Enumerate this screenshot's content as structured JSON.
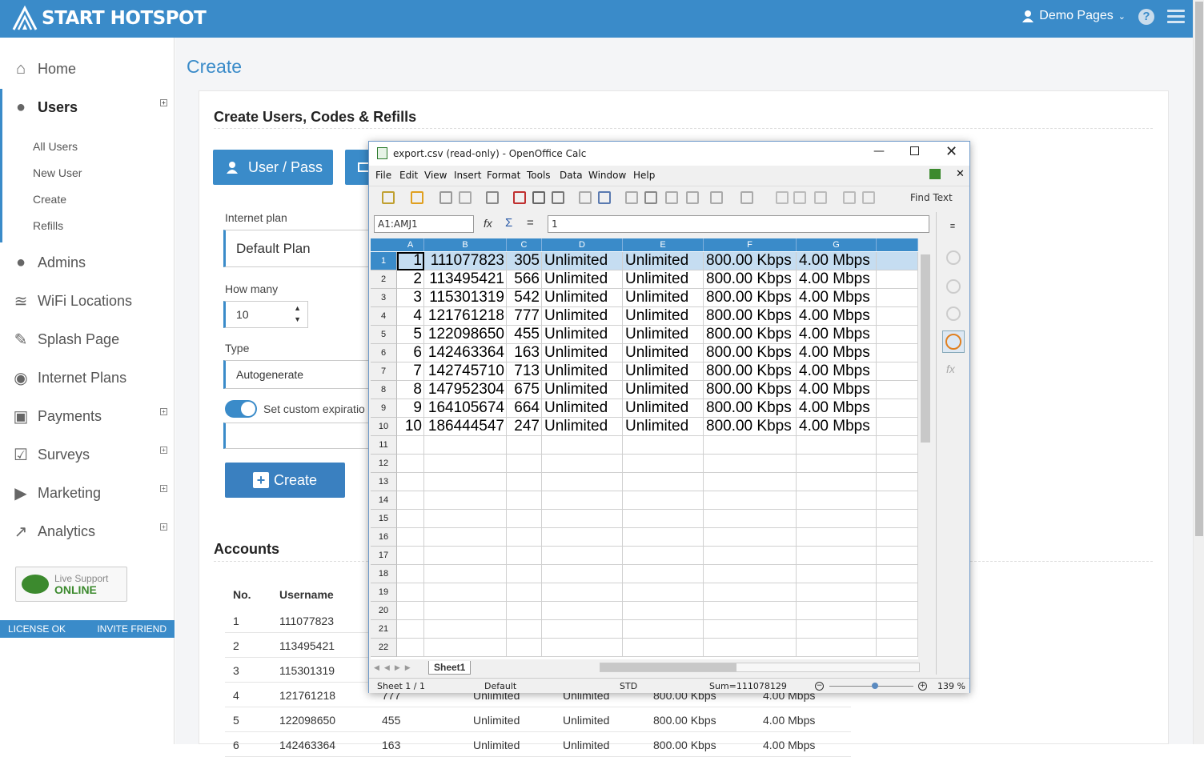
{
  "app": {
    "logo": "START HOTSPOT",
    "user": "Demo Pages",
    "help": "?"
  },
  "sidebar": {
    "items": [
      {
        "label": "Home",
        "icon": "home-icon",
        "plus": false
      },
      {
        "label": "Users",
        "icon": "user-icon",
        "plus": true
      },
      {
        "label": "Admins",
        "icon": "user-icon",
        "plus": false
      },
      {
        "label": "WiFi Locations",
        "icon": "wifi-icon",
        "plus": false
      },
      {
        "label": "Splash Page",
        "icon": "edit-icon",
        "plus": false
      },
      {
        "label": "Internet Plans",
        "icon": "globe-icon",
        "plus": false
      },
      {
        "label": "Payments",
        "icon": "credit-card-icon",
        "plus": true
      },
      {
        "label": "Surveys",
        "icon": "checkbox-icon",
        "plus": true
      },
      {
        "label": "Marketing",
        "icon": "video-icon",
        "plus": true
      },
      {
        "label": "Analytics",
        "icon": "chart-icon",
        "plus": true
      }
    ],
    "sub": [
      "All Users",
      "New User",
      "Create",
      "Refills"
    ],
    "live_support": {
      "line1": "Live Support",
      "line2": "ONLINE"
    },
    "footer": {
      "left": "LICENSE OK",
      "right": "INVITE FRIEND"
    }
  },
  "page": {
    "title": "Create",
    "section": "Create Users, Codes & Refills",
    "accounts": "Accounts"
  },
  "form": {
    "tab_userpass": "User / Pass",
    "plan_label": "Internet plan",
    "plan_value": "Default Plan",
    "howmany_label": "How many",
    "howmany_value": "10",
    "type_label": "Type",
    "type_value": "Autogenerate",
    "expire_label": "Set custom expiratio",
    "create_btn": "Create"
  },
  "accounts": {
    "headers": [
      "No.",
      "Username"
    ],
    "rows": [
      {
        "no": "1",
        "user": "111077823",
        "pass": "",
        "a": "",
        "b": "",
        "c": "",
        "d": ""
      },
      {
        "no": "2",
        "user": "113495421",
        "pass": "",
        "a": "",
        "b": "",
        "c": "",
        "d": ""
      },
      {
        "no": "3",
        "user": "115301319",
        "pass": "",
        "a": "",
        "b": "",
        "c": "",
        "d": ""
      },
      {
        "no": "4",
        "user": "121761218",
        "pass": "777",
        "a": "Unlimited",
        "b": "Unlimited",
        "c": "800.00 Kbps",
        "d": "4.00 Mbps"
      },
      {
        "no": "5",
        "user": "122098650",
        "pass": "455",
        "a": "Unlimited",
        "b": "Unlimited",
        "c": "800.00 Kbps",
        "d": "4.00 Mbps"
      },
      {
        "no": "6",
        "user": "142463364",
        "pass": "163",
        "a": "Unlimited",
        "b": "Unlimited",
        "c": "800.00 Kbps",
        "d": "4.00 Mbps"
      }
    ]
  },
  "calc": {
    "title": "export.csv (read-only) - OpenOffice Calc",
    "menu": [
      "File",
      "Edit",
      "View",
      "Insert",
      "Format",
      "Tools",
      "Data",
      "Window",
      "Help"
    ],
    "find_text": "Find Text",
    "namebox": "A1:AMJ1",
    "formula": "1",
    "cols": [
      "A",
      "B",
      "C",
      "D",
      "E",
      "F",
      "G"
    ],
    "rows": [
      [
        "1",
        "111077823",
        "305",
        "Unlimited",
        "Unlimited",
        "800.00 Kbps",
        "4.00 Mbps"
      ],
      [
        "2",
        "113495421",
        "566",
        "Unlimited",
        "Unlimited",
        "800.00 Kbps",
        "4.00 Mbps"
      ],
      [
        "3",
        "115301319",
        "542",
        "Unlimited",
        "Unlimited",
        "800.00 Kbps",
        "4.00 Mbps"
      ],
      [
        "4",
        "121761218",
        "777",
        "Unlimited",
        "Unlimited",
        "800.00 Kbps",
        "4.00 Mbps"
      ],
      [
        "5",
        "122098650",
        "455",
        "Unlimited",
        "Unlimited",
        "800.00 Kbps",
        "4.00 Mbps"
      ],
      [
        "6",
        "142463364",
        "163",
        "Unlimited",
        "Unlimited",
        "800.00 Kbps",
        "4.00 Mbps"
      ],
      [
        "7",
        "142745710",
        "713",
        "Unlimited",
        "Unlimited",
        "800.00 Kbps",
        "4.00 Mbps"
      ],
      [
        "8",
        "147952304",
        "675",
        "Unlimited",
        "Unlimited",
        "800.00 Kbps",
        "4.00 Mbps"
      ],
      [
        "9",
        "164105674",
        "664",
        "Unlimited",
        "Unlimited",
        "800.00 Kbps",
        "4.00 Mbps"
      ],
      [
        "10",
        "186444547",
        "247",
        "Unlimited",
        "Unlimited",
        "800.00 Kbps",
        "4.00 Mbps"
      ]
    ],
    "row_numbers": [
      "1",
      "2",
      "3",
      "4",
      "5",
      "6",
      "7",
      "8",
      "9",
      "10",
      "11",
      "12",
      "13",
      "14",
      "15",
      "16",
      "17",
      "18",
      "19",
      "20",
      "21",
      "22"
    ],
    "sheet_tab": "Sheet1",
    "status": {
      "sheet": "Sheet 1 / 1",
      "style": "Default",
      "mode": "STD",
      "sum": "Sum=111078129",
      "zoom": "139 %"
    }
  },
  "colors": {
    "accent": "#3a8bc9",
    "selection": "#c5ddf1"
  }
}
